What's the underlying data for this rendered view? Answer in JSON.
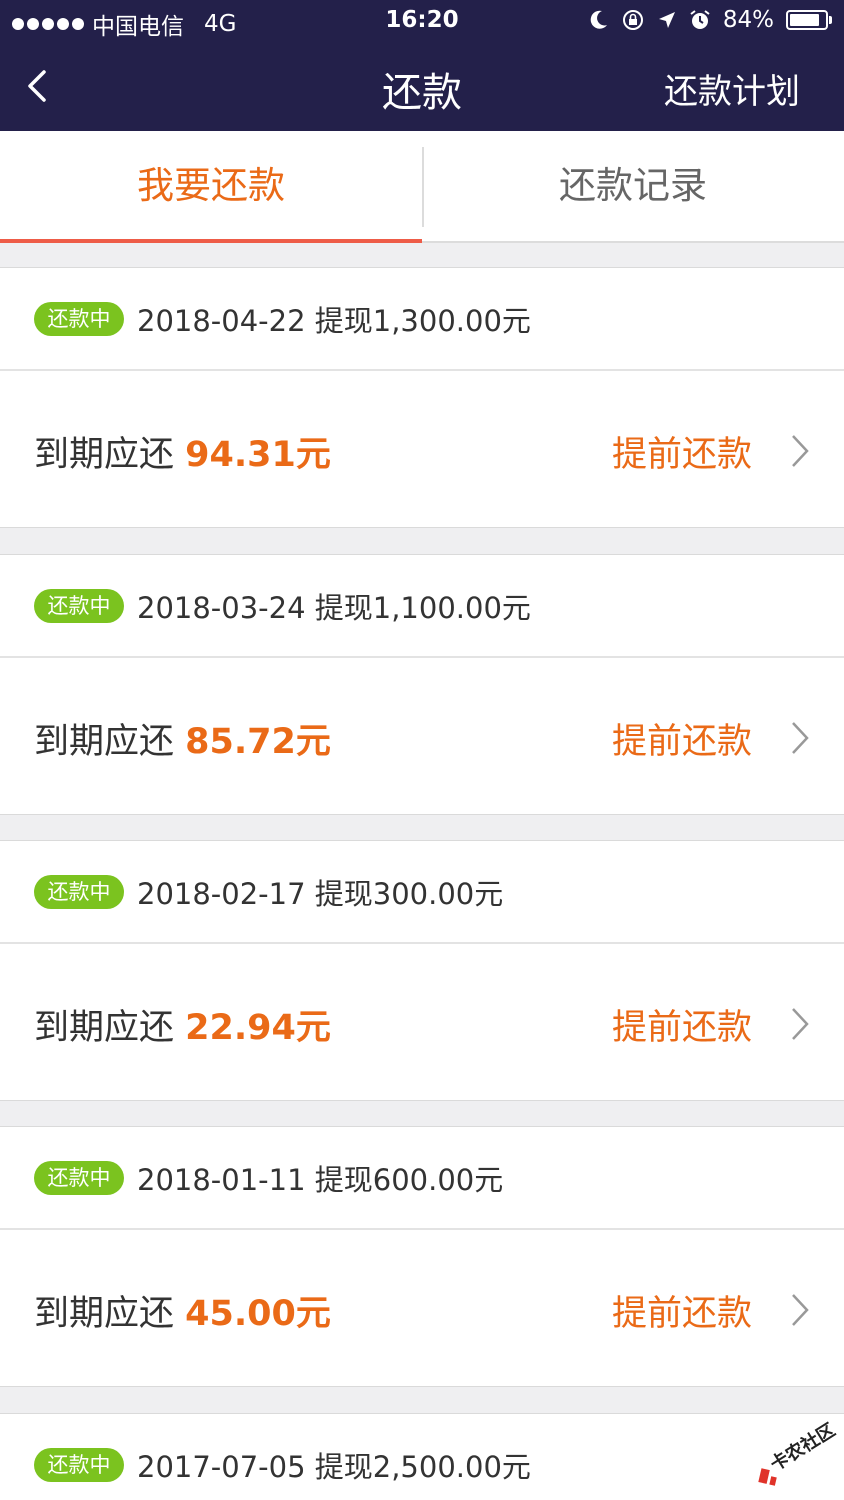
{
  "status_bar": {
    "carrier": "中国电信",
    "network": "4G",
    "time": "16:20",
    "battery": "84%",
    "battery_level": 0.84,
    "icons": [
      "moon-icon",
      "rotation-lock-icon",
      "location-arrow-icon",
      "alarm-icon",
      "battery-icon"
    ]
  },
  "nav": {
    "title": "还款",
    "right_label": "还款计划",
    "back_icon": "chevron-left-icon"
  },
  "tabs": [
    {
      "label": "我要还款",
      "active": true
    },
    {
      "label": "还款记录",
      "active": false
    }
  ],
  "colors": {
    "nav_bg": "#23204a",
    "accent_orange": "#ea6a17",
    "badge_green": "#7bc31f",
    "tab_underline": "#ee5c48"
  },
  "loans": [
    {
      "status": "还款中",
      "date": "2018-04-22",
      "withdraw": "提现1,300.00元",
      "due_label": "到期应还",
      "due_amount": "94.31元",
      "action": "提前还款"
    },
    {
      "status": "还款中",
      "date": "2018-03-24",
      "withdraw": "提现1,100.00元",
      "due_label": "到期应还",
      "due_amount": "85.72元",
      "action": "提前还款"
    },
    {
      "status": "还款中",
      "date": "2018-02-17",
      "withdraw": "提现300.00元",
      "due_label": "到期应还",
      "due_amount": "22.94元",
      "action": "提前还款"
    },
    {
      "status": "还款中",
      "date": "2018-01-11",
      "withdraw": "提现600.00元",
      "due_label": "到期应还",
      "due_amount": "45.00元",
      "action": "提前还款"
    },
    {
      "status": "还款中",
      "date": "2017-07-05",
      "withdraw": "提现2,500.00元"
    }
  ],
  "watermark": {
    "text": "卡农社区"
  }
}
